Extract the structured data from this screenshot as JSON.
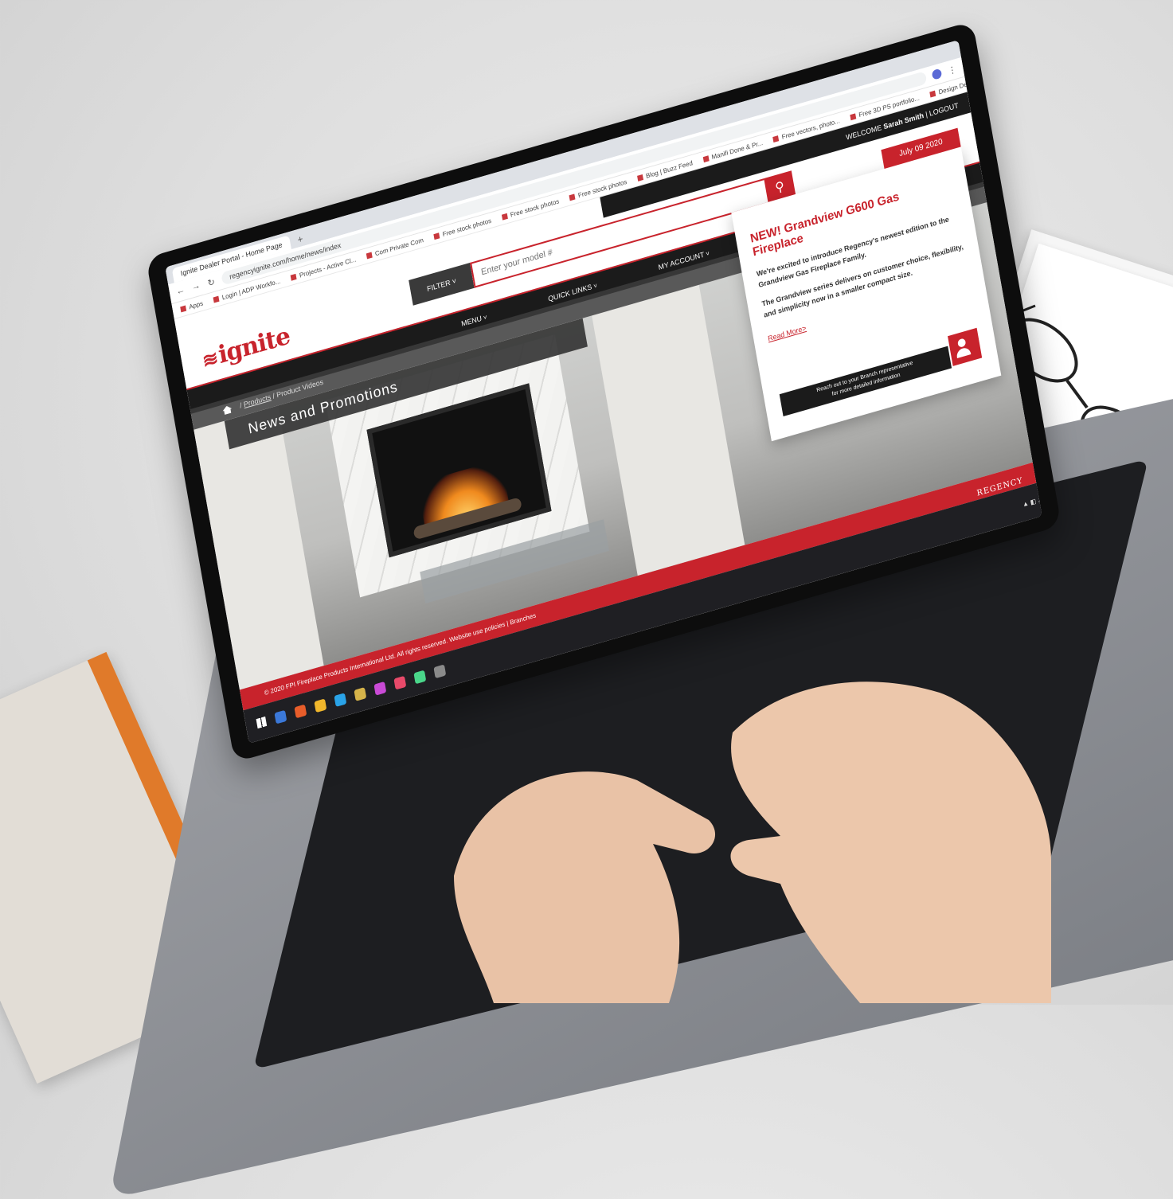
{
  "browser": {
    "tabs": [
      "Ignite Dealer Portal - Home Page"
    ],
    "new_tab": "+",
    "url": "regencyignite.com/home/news/index",
    "bookmarks": [
      "Apps",
      "Login | ADP Workfo...",
      "Projects - Active Cl...",
      "Com Private Com",
      "Free stock photos",
      "Free stock photos",
      "Free stock photos",
      "Blog | Buzz Feed",
      "Manifi Done & Pr...",
      "Free vectors, photo...",
      "Free 3D PS portfolio...",
      "Design Deals Here"
    ]
  },
  "site": {
    "logo": "ignite",
    "welcome_label": "WELCOME",
    "user_name": "Sarah Smith",
    "separator": "|",
    "logout": "LOGOUT",
    "filter_label": "FILTER",
    "search_placeholder": "Enter your model #",
    "menu": [
      "MENU",
      "QUICK LINKS",
      "MY ACCOUNT"
    ],
    "breadcrumb": {
      "link": "Products",
      "separator": "/",
      "current": "Product Videos"
    },
    "page_title": "News and Promotions"
  },
  "promo": {
    "date": "July 09 2020",
    "title": "NEW! Grandview G600 Gas Fireplace",
    "paragraph1": "We're excited to introduce Regency's newest edition to the Grandview Gas Fireplace Family.",
    "paragraph2": "The Grandview series delivers on customer choice, flexibility, and simplicity now in a smaller compact size.",
    "read_more": "Read More>",
    "contact_line1": "Reach out to your Branch representative",
    "contact_line2": "for more detailed information"
  },
  "footer": {
    "copyright": "© 2020 FPI Fireplace Products International Ltd. All rights reserved.",
    "links": "Website use policies | Branches",
    "brand": "REGENCY"
  },
  "colors": {
    "accent": "#c8232c",
    "dark": "#1b1b1b"
  }
}
